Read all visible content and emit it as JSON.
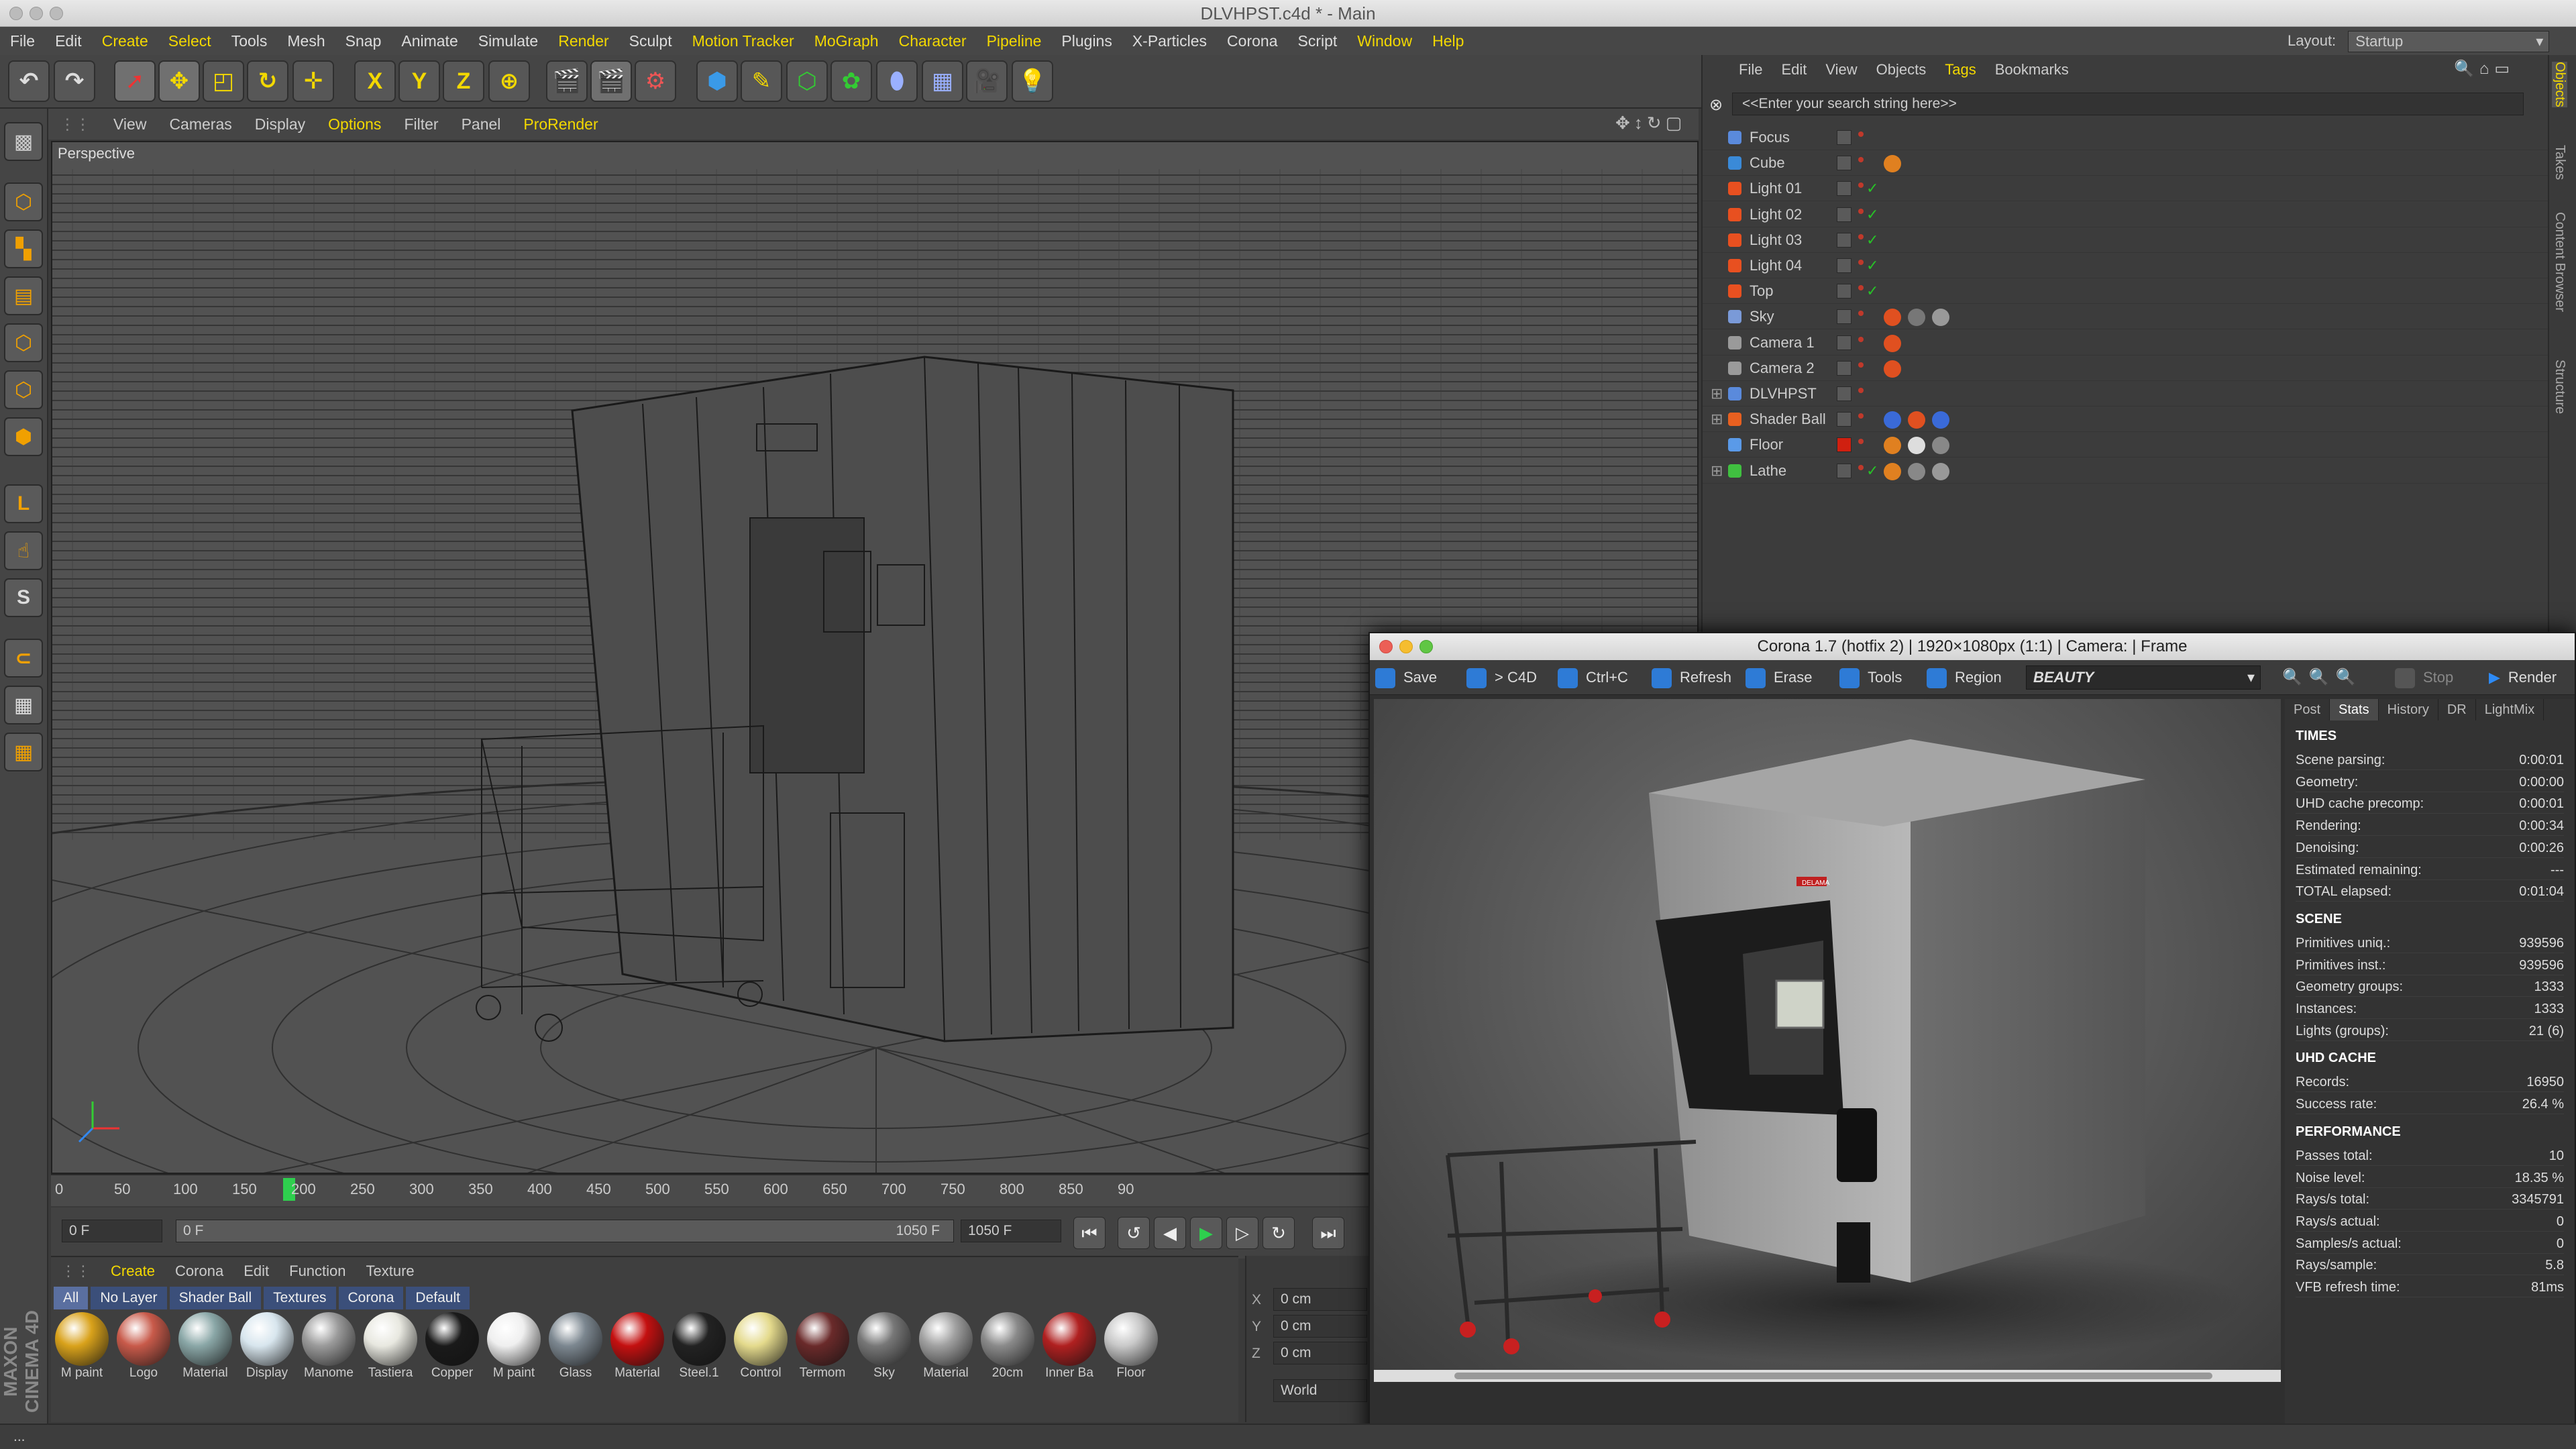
{
  "window": {
    "title": "DLVHPST.c4d * - Main"
  },
  "menu": {
    "items": [
      "File",
      "Edit",
      "Create",
      "Select",
      "Tools",
      "Mesh",
      "Snap",
      "Animate",
      "Simulate",
      "Render",
      "Sculpt",
      "Motion Tracker",
      "MoGraph",
      "Character",
      "Pipeline",
      "Plugins",
      "X-Particles",
      "Corona",
      "Script",
      "Window",
      "Help"
    ],
    "layout_label": "Layout:",
    "layout_value": "Startup"
  },
  "toolbar": {
    "axis_x": "X",
    "axis_y": "Y",
    "axis_z": "Z"
  },
  "viewport": {
    "menu": [
      "View",
      "Cameras",
      "Display",
      "Options",
      "Filter",
      "Panel",
      "ProRender"
    ],
    "label": "Perspective"
  },
  "timeline": {
    "ticks": [
      "0",
      "50",
      "100",
      "150",
      "200",
      "250",
      "300",
      "350",
      "400",
      "450",
      "500",
      "550",
      "600",
      "650",
      "700",
      "750",
      "800",
      "850",
      "90"
    ],
    "current": "150",
    "start_field": "0 F",
    "range_start": "0 F",
    "range_end": "1050 F",
    "end_field": "1050 F"
  },
  "materials": {
    "menu": [
      "Create",
      "Corona",
      "Edit",
      "Function",
      "Texture"
    ],
    "tabs": [
      "All",
      "No Layer",
      "Shader Ball",
      "Textures",
      "Corona",
      "Default"
    ],
    "items": [
      {
        "name": "M paint",
        "color": "#d9a21b"
      },
      {
        "name": "Logo",
        "color": "#c85a4a"
      },
      {
        "name": "Material",
        "color": "#8aa7a7"
      },
      {
        "name": "Display",
        "color": "#d8e6ee"
      },
      {
        "name": "Manome",
        "color": "#9a9a9a"
      },
      {
        "name": "Tastiera",
        "color": "#e8e8e0"
      },
      {
        "name": "Copper",
        "color": "#1a1a1a"
      },
      {
        "name": "M paint",
        "color": "#efefef"
      },
      {
        "name": "Glass",
        "color": "#7c8790"
      },
      {
        "name": "Material",
        "color": "#c41010"
      },
      {
        "name": "Steel.1",
        "color": "#222222"
      },
      {
        "name": "Control",
        "color": "#e4da8c"
      },
      {
        "name": "Termom",
        "color": "#6a2a2a"
      },
      {
        "name": "Sky",
        "color": "#777777"
      },
      {
        "name": "Material",
        "color": "#a0a0a0"
      },
      {
        "name": "20cm",
        "color": "#8a8a8a"
      },
      {
        "name": "Inner Ba",
        "color": "#b02020"
      },
      {
        "name": "Floor",
        "color": "#c8c8c8"
      }
    ]
  },
  "coords": {
    "x": "X",
    "y": "Y",
    "z": "Z",
    "x_val": "0 cm",
    "y_val": "0 cm",
    "z_val": "0 cm",
    "space": "World"
  },
  "objects": {
    "menu": [
      "File",
      "Edit",
      "View",
      "Objects",
      "Tags",
      "Bookmarks"
    ],
    "search_placeholder": "<<Enter your search string here>>",
    "rows": [
      {
        "name": "Focus",
        "icon": "#5a8adc"
      },
      {
        "name": "Cube",
        "icon": "#3a8ad8"
      },
      {
        "name": "Light 01",
        "icon": "#e85020"
      },
      {
        "name": "Light 02",
        "icon": "#e85020"
      },
      {
        "name": "Light 03",
        "icon": "#e85020"
      },
      {
        "name": "Light 04",
        "icon": "#e85020"
      },
      {
        "name": "Top",
        "icon": "#e85020"
      },
      {
        "name": "Sky",
        "icon": "#7a9ad8"
      },
      {
        "name": "Camera 1",
        "icon": "#9a9a9a"
      },
      {
        "name": "Camera 2",
        "icon": "#9a9a9a"
      },
      {
        "name": "DLVHPST",
        "icon": "#5a8adc"
      },
      {
        "name": "Shader Ball",
        "icon": "#e86020"
      },
      {
        "name": "Floor",
        "icon": "#5a9ae8"
      },
      {
        "name": "Lathe",
        "icon": "#40c040"
      }
    ]
  },
  "sidetabs": [
    "Objects",
    "Takes",
    "Content Browser",
    "Structure"
  ],
  "vfb": {
    "title": "Corona 1.7 (hotfix 2) | 1920×1080px (1:1) | Camera:  | Frame",
    "tools": {
      "save": "Save",
      "c4d": "> C4D",
      "copy": "Ctrl+C",
      "refresh": "Refresh",
      "erase": "Erase",
      "tools": "Tools",
      "region": "Region",
      "pass": "BEAUTY",
      "stop": "Stop",
      "render": "Render"
    },
    "stat_tabs": [
      "Post",
      "Stats",
      "History",
      "DR",
      "LightMix"
    ],
    "sections": {
      "times": "TIMES",
      "scene": "SCENE",
      "uhd": "UHD CACHE",
      "perf": "PERFORMANCE"
    },
    "times": [
      [
        "Scene parsing:",
        "0:00:01"
      ],
      [
        "Geometry:",
        "0:00:00"
      ],
      [
        "UHD cache precomp:",
        "0:00:01"
      ],
      [
        "Rendering:",
        "0:00:34"
      ],
      [
        "Denoising:",
        "0:00:26"
      ],
      [
        "Estimated remaining:",
        "---"
      ],
      [
        "TOTAL elapsed:",
        "0:01:04"
      ]
    ],
    "scene": [
      [
        "Primitives uniq.:",
        "939596"
      ],
      [
        "Primitives inst.:",
        "939596"
      ],
      [
        "Geometry groups:",
        "1333"
      ],
      [
        "Instances:",
        "1333"
      ],
      [
        "Lights (groups):",
        "21 (6)"
      ]
    ],
    "uhd": [
      [
        "Records:",
        "16950"
      ],
      [
        "Success rate:",
        "26.4 %"
      ]
    ],
    "perf": [
      [
        "Passes total:",
        "10"
      ],
      [
        "Noise level:",
        "18.35 %"
      ],
      [
        "Rays/s total:",
        "3345791"
      ],
      [
        "Rays/s actual:",
        "0"
      ],
      [
        "Samples/s actual:",
        "0"
      ],
      [
        "Rays/sample:",
        "5.8"
      ],
      [
        "VFB refresh time:",
        "81ms"
      ]
    ],
    "logo_text": "DELAMA"
  },
  "brand": "MAXON CINEMA 4D",
  "status": "..."
}
